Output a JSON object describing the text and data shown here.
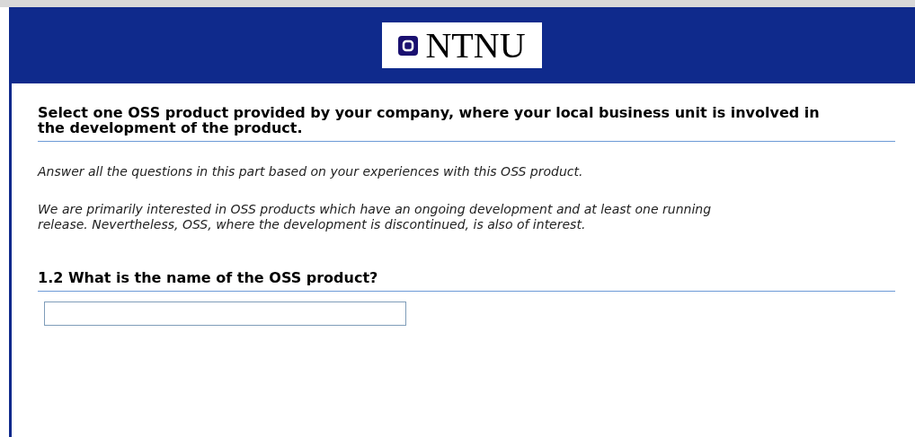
{
  "header": {
    "logo_text": "NTNU"
  },
  "section": {
    "title": "Select one OSS product provided by your company, where your local business unit is involved in the development of the product.",
    "intro": [
      "Answer all the questions in this part based on your experiences with this OSS product.",
      "We are primarily interested in OSS products which have an ongoing development and at least one running release. Nevertheless, OSS, where the development is discontinued, is also of interest."
    ]
  },
  "question": {
    "title": "1.2 What is the name of the OSS product?"
  }
}
